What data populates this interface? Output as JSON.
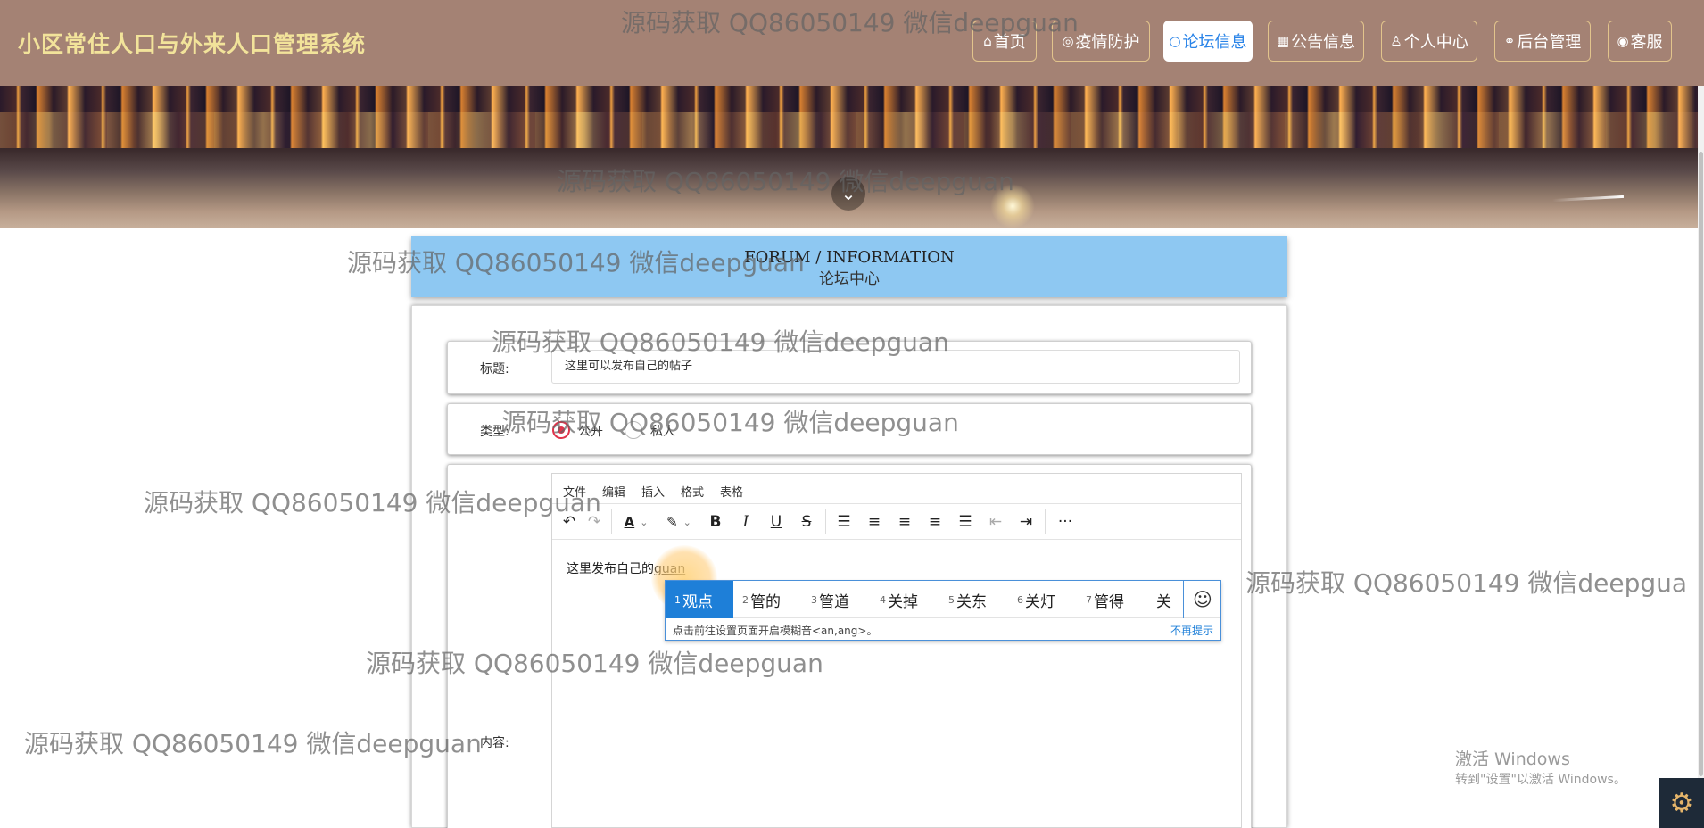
{
  "nav": {
    "title": "小区常住人口与外来人口管理系统",
    "items": [
      {
        "icon": "⌂",
        "label": "首页"
      },
      {
        "icon": "◎",
        "label": "疫情防护"
      },
      {
        "icon": "○",
        "label": "论坛信息"
      },
      {
        "icon": "▦",
        "label": "公告信息"
      },
      {
        "icon": "♙",
        "label": "个人中心"
      },
      {
        "icon": "⚭",
        "label": "后台管理"
      },
      {
        "icon": "◉",
        "label": "客服"
      }
    ],
    "active_index": 2
  },
  "forum_header": {
    "en": "FORUM / INFORMATION",
    "zh": "论坛中心"
  },
  "form": {
    "title_label": "标题:",
    "title_value": "这里可以发布自己的帖子",
    "type_label": "类型:",
    "type_options": [
      "公开",
      "私人"
    ],
    "type_selected": "公开",
    "content_label": "内容:"
  },
  "editor": {
    "menus": [
      "文件",
      "编辑",
      "插入",
      "格式",
      "表格"
    ],
    "toolbar_icons": [
      "undo-icon",
      "redo-icon",
      "font-color-icon",
      "highlight-icon",
      "bold-icon",
      "italic-icon",
      "underline-icon",
      "strikethrough-icon",
      "line-height-icon",
      "align-left-icon",
      "align-center-icon",
      "align-right-icon",
      "align-justify-icon",
      "outdent-icon",
      "indent-icon",
      "more-icon"
    ],
    "content_text": "这里发布自己的",
    "content_pinyin": "guan"
  },
  "ime": {
    "candidates": [
      {
        "n": "1",
        "t": "观点"
      },
      {
        "n": "2",
        "t": "管的"
      },
      {
        "n": "3",
        "t": "管道"
      },
      {
        "n": "4",
        "t": "关掉"
      },
      {
        "n": "5",
        "t": "关东"
      },
      {
        "n": "6",
        "t": "关灯"
      },
      {
        "n": "7",
        "t": "管得"
      },
      {
        "n": "",
        "t": "关"
      }
    ],
    "hint": "点击前往设置页面开启模糊音<an,ang>。",
    "dismiss": "不再提示"
  },
  "watermarks": [
    "源码获取 QQ86050149 微信deepguan",
    "源码获取 QQ86050149 微信deepguan",
    "源码获取 QQ86050149 微信deepguan",
    "源码获取 QQ86050149 微信deepguan",
    "源码获取 QQ86050149 微信deepguan",
    "源码获取 QQ86050149 微信deepguan",
    "源码获取 QQ86050149 微信deepguan",
    "源码获取 QQ86050149 微信deepguan",
    "源码获取 QQ86050149 微信deepgua"
  ],
  "windows_activation": {
    "line1": "激活 Windows",
    "line2": "转到\"设置\"以激活 Windows。"
  },
  "colors": {
    "nav_bg": "#a48274",
    "title": "#f2e39a",
    "forum_header_bg": "#8ec8f2",
    "ime_selected": "#1e7fd8",
    "radio_selected": "#e0334a"
  }
}
